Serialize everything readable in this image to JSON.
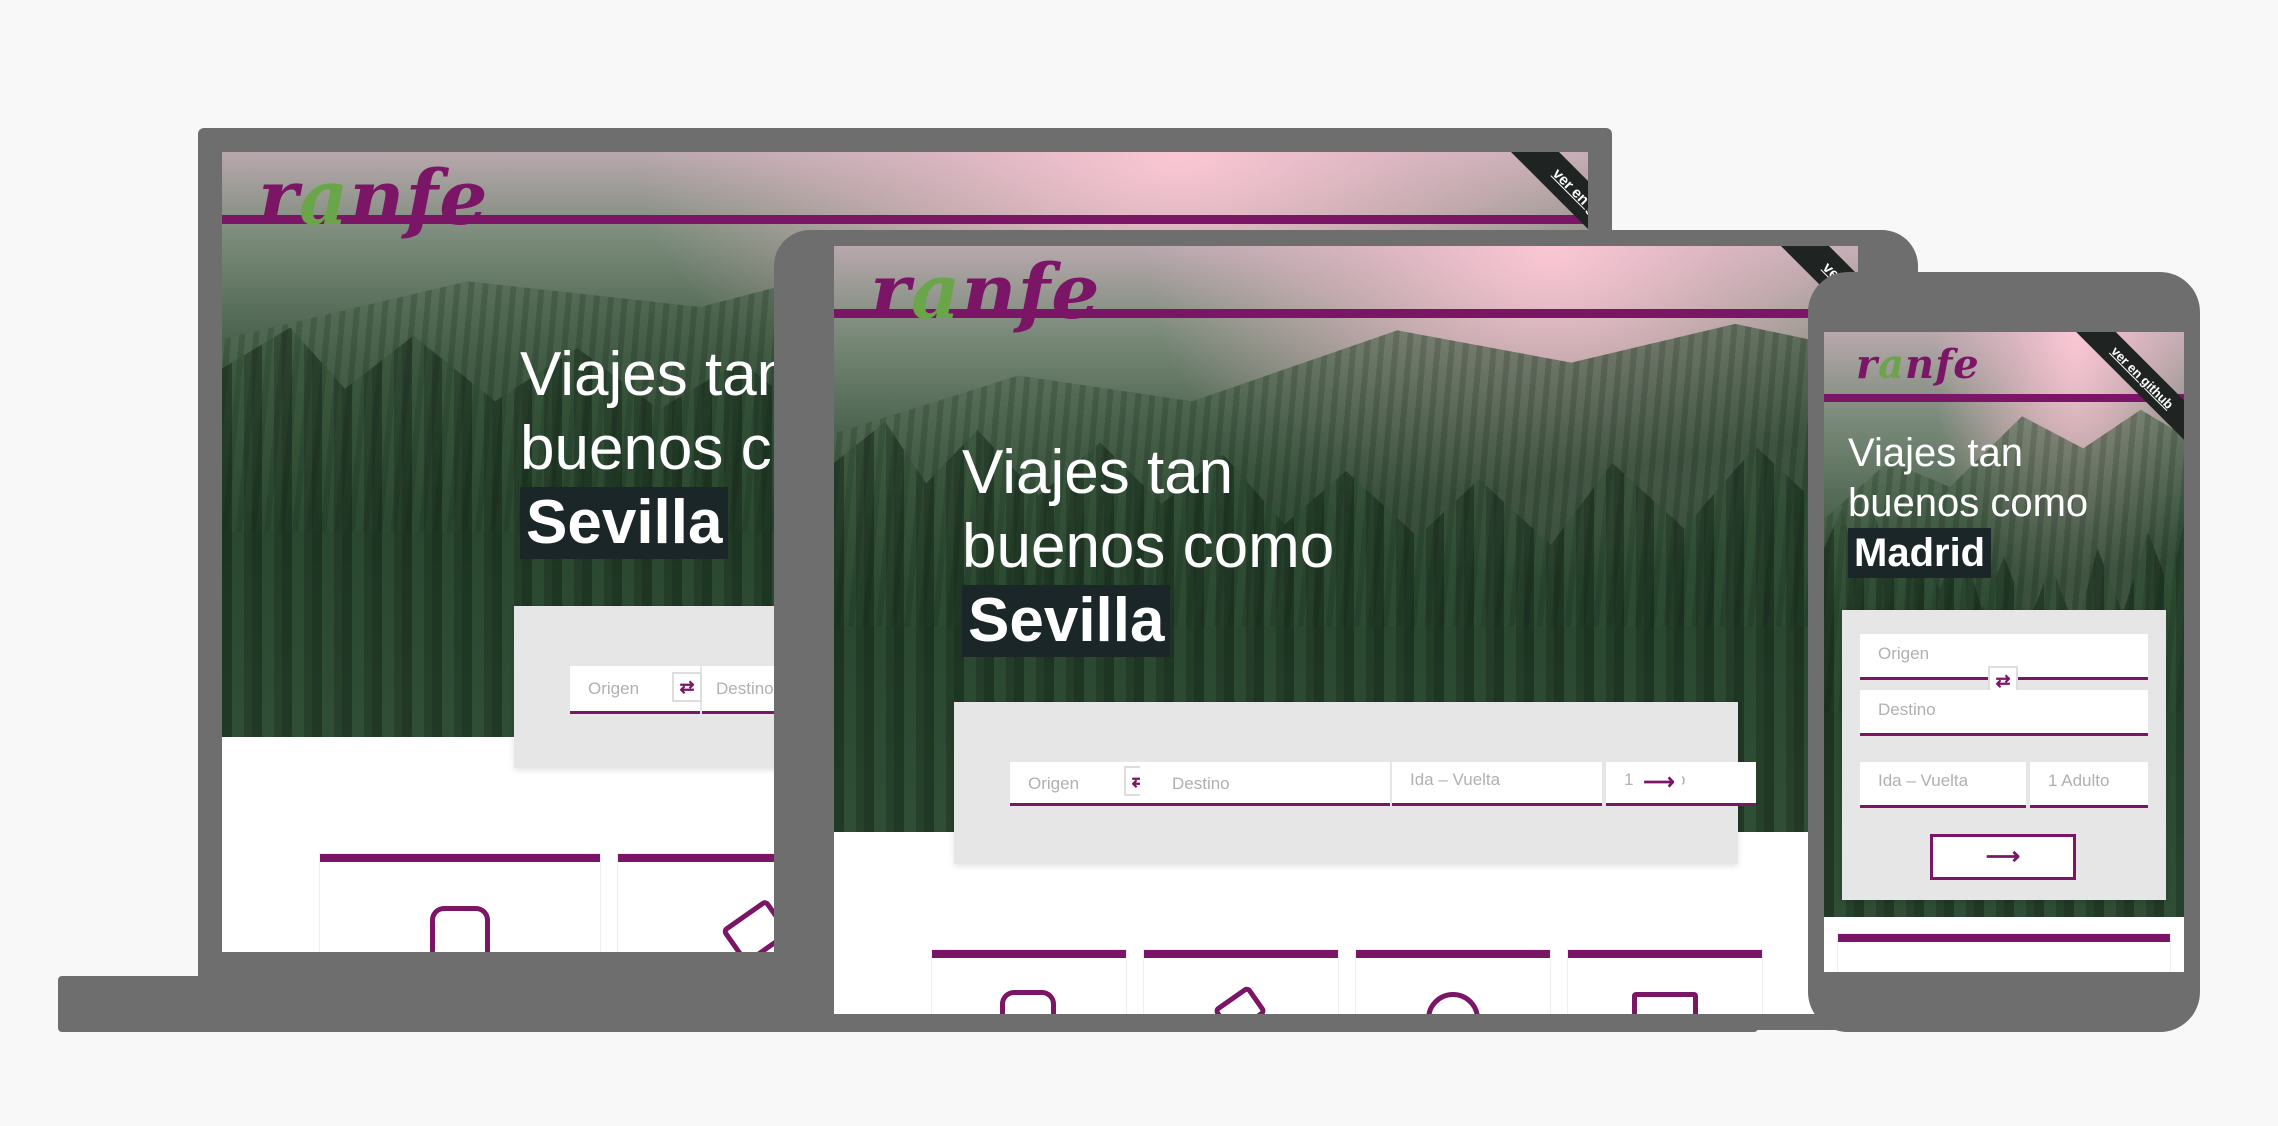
{
  "brand": {
    "logo_r": "r",
    "logo_a": "a",
    "logo_rest": "nfe"
  },
  "github_ribbon": "ver en github",
  "headline": {
    "line1": "Viajes tan",
    "line2": "buenos como"
  },
  "cities": {
    "laptop": "Sevilla",
    "tablet": "Sevilla",
    "phone": "Madrid"
  },
  "search": {
    "origin_placeholder": "Origen",
    "destination_placeholder": "Destino",
    "dates_placeholder": "Ida – Vuelta",
    "passengers_placeholder": "1 Adulto",
    "swap_icon": "⇄",
    "submit_icon": "⟶"
  },
  "colors": {
    "brand": "#7b1566",
    "accent_green": "#6aa54a",
    "device_frame": "#6e6e6e",
    "panel_bg": "#e6e6e6"
  }
}
